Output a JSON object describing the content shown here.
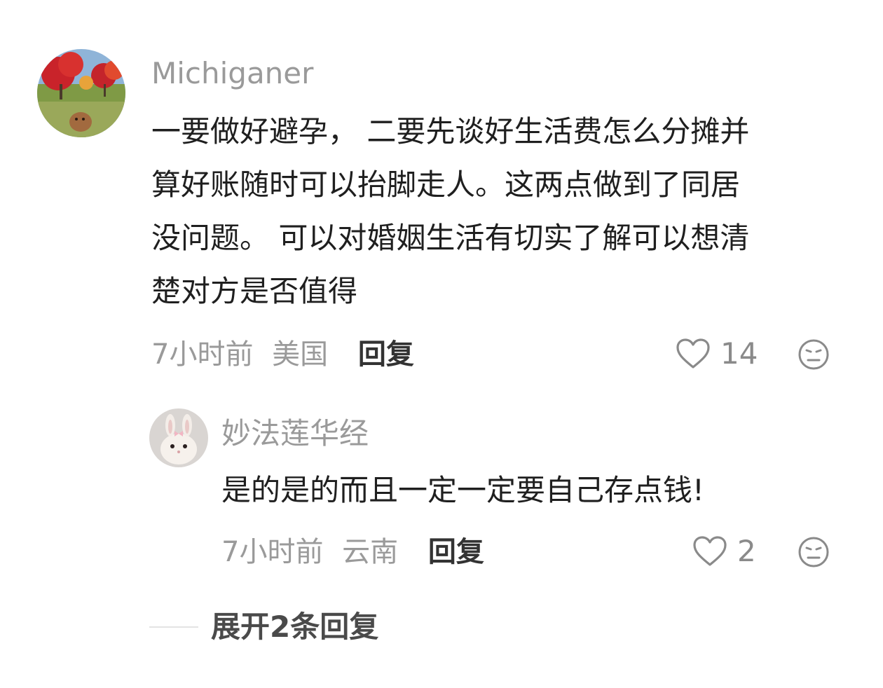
{
  "comments": [
    {
      "username": "Michiganer",
      "text_lines": [
        "一要做好避孕， 二要先谈好生活费怎么分摊并",
        "算好账随时可以抬脚走人。这两点做到了同居",
        "没问题。 可以对婚姻生活有切实了解可以想清",
        "楚对方是否值得"
      ],
      "time": "7小时前",
      "location": "美国",
      "reply_label": "回复",
      "likes": "14",
      "like_icon": "heart-outline-icon",
      "dislike_icon": "neutral-face-icon"
    },
    {
      "username": "妙法莲华经",
      "text_lines": [
        "是的是的而且一定一定要自己存点钱!"
      ],
      "time": "7小时前",
      "location": "云南",
      "reply_label": "回复",
      "likes": "2",
      "like_icon": "heart-outline-icon",
      "dislike_icon": "neutral-face-icon"
    }
  ],
  "expand_replies_label": "展开2条回复",
  "colors": {
    "username": "#9a9a9a",
    "text": "#1f1f1f",
    "meta": "#9a9a9a",
    "reply_button": "#333333"
  }
}
